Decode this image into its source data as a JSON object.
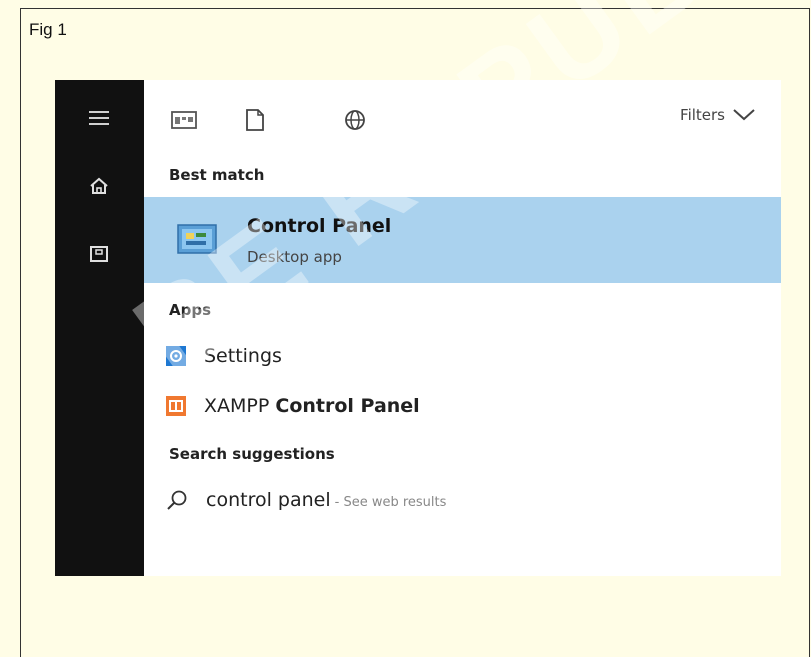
{
  "figure": {
    "label": "Fig 1"
  },
  "watermark": "BE REPUBLISHED",
  "rail": {
    "items": [
      {
        "name": "menu-icon"
      },
      {
        "name": "home-icon"
      },
      {
        "name": "documents-icon"
      }
    ]
  },
  "toolbar": {
    "filters_label": "Filters",
    "icons": [
      "apps-icon",
      "document-icon",
      "web-icon"
    ]
  },
  "best_match": {
    "header": "Best match",
    "title": "Control Panel",
    "subtitle": "Desktop app",
    "highlight_color": "#aad2ee"
  },
  "apps": {
    "header": "Apps",
    "items": [
      {
        "label": "Settings",
        "icon": "settings-icon",
        "color": "#1e78d2"
      },
      {
        "label_prefix": "XAMPP ",
        "label_bold": "Control Panel",
        "icon": "xampp-icon",
        "color": "#f07830"
      }
    ]
  },
  "suggestions": {
    "header": "Search suggestions",
    "query": "control panel",
    "hint": "- See web results"
  }
}
